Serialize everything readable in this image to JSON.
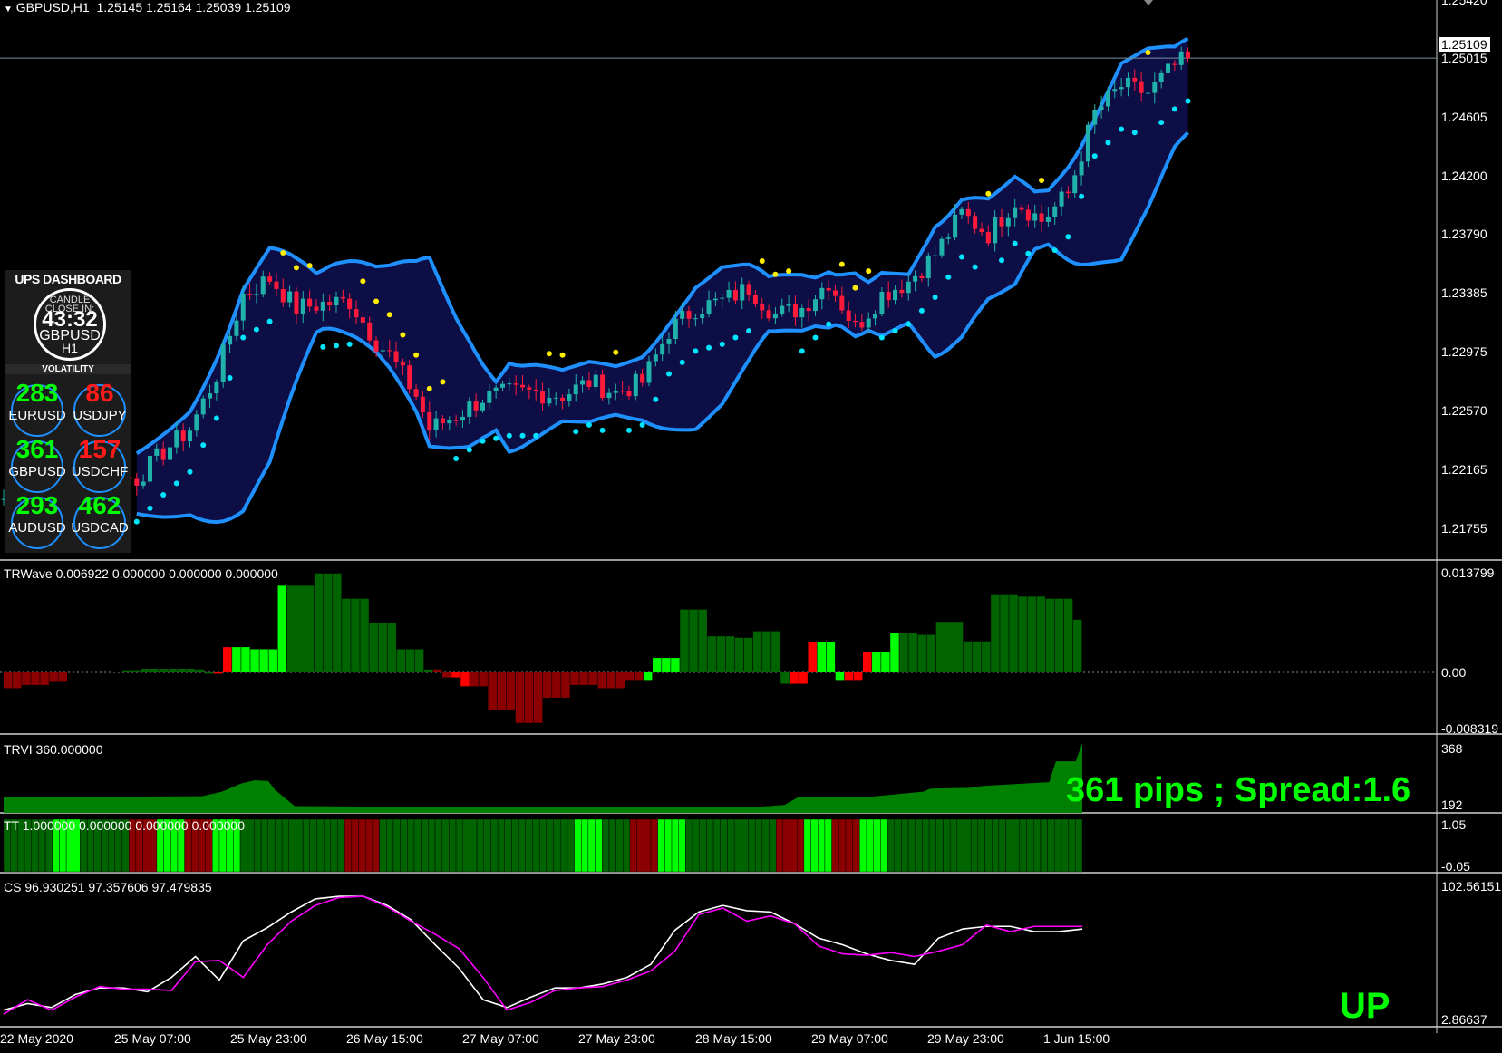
{
  "chart_header": {
    "symbol_label": "GBPUSD,H1",
    "ohlc": "1.25145 1.25164 1.25039 1.25109"
  },
  "price_axis": {
    "ticks": [
      "1.25420",
      "1.25015",
      "1.24605",
      "1.24200",
      "1.23790",
      "1.23385",
      "1.22975",
      "1.22570",
      "1.22165",
      "1.21755"
    ],
    "current_price": "1.25109"
  },
  "dashboard": {
    "title": "UPS DASHBOARD",
    "candle_close_label": "CANDLE CLOSE IN:",
    "timer": "43:32",
    "symbol": "GBPUSD",
    "timeframe": "H1",
    "volatility_label": "VOLATILITY",
    "pairs": [
      {
        "name": "EURUSD",
        "value": "283",
        "color": "#00ff00"
      },
      {
        "name": "USDJPY",
        "value": "86",
        "color": "#ff1a1a"
      },
      {
        "name": "GBPUSD",
        "value": "361",
        "color": "#00ff00"
      },
      {
        "name": "USDCHF",
        "value": "157",
        "color": "#ff1a1a"
      },
      {
        "name": "AUDUSD",
        "value": "293",
        "color": "#00ff00"
      },
      {
        "name": "USDCAD",
        "value": "462",
        "color": "#00ff00"
      }
    ]
  },
  "trwave": {
    "label": "TRWave 0.006922 0.000000 0.000000 0.000000",
    "axis": [
      "0.013799",
      "0.00",
      "-0.008319"
    ]
  },
  "trvi": {
    "label": "TRVI 360.000000",
    "axis": [
      "368",
      "192"
    ],
    "overlay": "361 pips ; Spread:1.6"
  },
  "tt": {
    "label": "TT 1.000000 0.000000 0.000000 0.000000",
    "axis": [
      "1.05",
      "-0.05"
    ]
  },
  "cs": {
    "label": "CS 96.930251 97.357606 97.479835",
    "axis": [
      "102.56151",
      "2.86637"
    ],
    "signal": "UP"
  },
  "time_axis": [
    "22 May 2020",
    "25 May 07:00",
    "25 May 23:00",
    "26 May 15:00",
    "27 May 07:00",
    "27 May 23:00",
    "28 May 15:00",
    "29 May 07:00",
    "29 May 23:00",
    "1 Jun 15:00"
  ],
  "colors": {
    "bull_candle": "#20b2aa",
    "bear_candle": "#ff1a3c",
    "band": "#1e90ff",
    "band_fill": "#1a1a80",
    "sar_up": "#00e5ff",
    "sar_down": "#ffee00",
    "hist_dark_green": "#006400",
    "hist_light_green": "#00ff00",
    "hist_dark_red": "#8b0000",
    "hist_red": "#ff0000",
    "cs_fast": "#ffffff",
    "cs_slow": "#ff00ff"
  },
  "chart_data": [
    {
      "type": "candlestick",
      "title": "GBPUSD,H1",
      "ylim": [
        1.2155,
        1.2542
      ],
      "close_trend": [
        [
          0,
          1.2183
        ],
        [
          4,
          1.2182
        ],
        [
          8,
          1.219
        ],
        [
          12,
          1.2195
        ],
        [
          16,
          1.2198
        ],
        [
          20,
          1.2198
        ],
        [
          24,
          1.2218
        ],
        [
          28,
          1.2235
        ],
        [
          32,
          1.2275
        ],
        [
          36,
          1.2335
        ],
        [
          40,
          1.2347
        ],
        [
          42,
          1.2336
        ],
        [
          44,
          1.2325
        ],
        [
          48,
          1.2328
        ],
        [
          52,
          1.233
        ],
        [
          56,
          1.23
        ],
        [
          58,
          1.229
        ],
        [
          62,
          1.226
        ],
        [
          64,
          1.2235
        ],
        [
          68,
          1.2245
        ],
        [
          72,
          1.2258
        ],
        [
          76,
          1.2262
        ],
        [
          80,
          1.2262
        ],
        [
          84,
          1.226
        ],
        [
          88,
          1.227
        ],
        [
          92,
          1.2262
        ],
        [
          96,
          1.227
        ],
        [
          100,
          1.2308
        ],
        [
          104,
          1.2325
        ],
        [
          108,
          1.233
        ],
        [
          112,
          1.234
        ],
        [
          116,
          1.232
        ],
        [
          120,
          1.2325
        ],
        [
          124,
          1.2345
        ],
        [
          128,
          1.231
        ],
        [
          132,
          1.2335
        ],
        [
          136,
          1.2345
        ],
        [
          140,
          1.2365
        ],
        [
          144,
          1.2395
        ],
        [
          148,
          1.238
        ],
        [
          152,
          1.2405
        ],
        [
          156,
          1.239
        ],
        [
          160,
          1.241
        ],
        [
          164,
          1.247
        ],
        [
          168,
          1.249
        ],
        [
          172,
          1.2485
        ],
        [
          176,
          1.2505
        ],
        [
          178,
          1.2511
        ]
      ]
    },
    {
      "type": "bar",
      "title": "TRWave",
      "ylim": [
        -0.008319,
        0.013799
      ],
      "values": [
        -0.0025,
        -0.0025,
        -0.002,
        -0.002,
        -0.002,
        -0.0015,
        -0.0015,
        0,
        0,
        0,
        0,
        0,
        0.0003,
        0.0003,
        0.0003,
        0.0005,
        0.0005,
        0.0005,
        0.0005,
        0.0005,
        0.0005,
        0.0004,
        -0.0002,
        -0.0002,
        0.0035,
        0.0035,
        0.0035,
        0.0032,
        0.0032,
        0.0032,
        0.012,
        0.012,
        0.012,
        0.012,
        0.0137,
        0.0137,
        0.0137,
        0.0102,
        0.0102,
        0.0102,
        0.0068,
        0.0068,
        0.0068,
        0.0032,
        0.0032,
        0.0032,
        0.0004,
        0.0004,
        -0.0008,
        -0.0008,
        -0.0022,
        -0.0022,
        -0.0022,
        -0.006,
        -0.006,
        -0.006,
        -0.008,
        -0.008,
        -0.008,
        -0.004,
        -0.004,
        -0.004,
        -0.002,
        -0.002,
        -0.002,
        -0.0025,
        -0.0025,
        -0.0025,
        -0.0012,
        -0.0012,
        -0.0012,
        0.002,
        0.002,
        0.002,
        0.0087,
        0.0087,
        0.0087,
        0.005,
        0.005,
        0.005,
        0.0048,
        0.0048,
        0.0057,
        0.0057,
        0.0057,
        -0.0018,
        -0.0018,
        -0.0018,
        0.0042,
        0.0042,
        0.0042,
        -0.0012,
        -0.0012,
        -0.0012,
        0.0028,
        0.0028,
        0.0028,
        0.0055,
        0.0055,
        0.0055,
        0.0052,
        0.0052,
        0.007,
        0.007,
        0.007,
        0.0043,
        0.0043,
        0.0043,
        0.0107,
        0.0107,
        0.0107,
        0.0105,
        0.0105,
        0.0105,
        0.0102,
        0.0102,
        0.0102,
        0.0073
      ],
      "color_codes": "RRRRRRR000000DDDDDDDDDDrrLLLLLLDDDDDDDDDDDDDDDDRRrrRRRRRRRRRRRRRRRRRRRLLLLDDDDDDDDDDDDrrrLLLrrrLLLDDDDDDDDDDDDDDDDDDDDDD"
    },
    {
      "type": "area",
      "title": "TRVI",
      "ylim": [
        192,
        368
      ],
      "x": [
        0,
        30,
        33,
        35,
        36,
        38,
        40,
        41,
        44,
        60,
        100,
        114,
        118,
        120,
        124,
        130,
        139,
        140,
        146,
        148,
        158,
        159,
        162,
        163
      ],
      "values": [
        225,
        228,
        240,
        255,
        262,
        270,
        268,
        245,
        202,
        200,
        200,
        200,
        205,
        225,
        225,
        225,
        240,
        248,
        250,
        255,
        265,
        320,
        320,
        368
      ]
    },
    {
      "type": "bar",
      "title": "TT",
      "ylim": [
        -0.05,
        1.05
      ],
      "color_codes": "DDDDDDDLLLLDDDDDDDRRRRLLLLRRRRLLLLDDDDDDDDDDDDDDDRRRRRDDDDDDDDDDDDDDDDDDDDDDDDDDDDLLLLDDDDRRRRLLLLDDDDDDDDDDDDDRRRRLLLLRRRRLLLLDDDDDDDDDDDDDDDDDDDDDDDDDDDD"
    },
    {
      "type": "line",
      "title": "CS",
      "ylim": [
        2.86637,
        102.56151
      ],
      "series": [
        {
          "values": [
            10,
            15,
            12,
            22,
            27,
            27,
            24,
            35,
            51,
            33,
            63,
            73,
            85,
            95,
            97,
            97,
            90,
            79,
            60,
            42,
            18,
            12,
            20,
            27,
            27,
            30,
            35,
            45,
            71,
            85,
            90,
            86,
            85,
            76,
            65,
            60,
            53,
            48,
            45,
            65,
            72,
            74,
            74,
            70,
            70,
            72
          ]
        },
        {
          "values": [
            7,
            18,
            10,
            20,
            28,
            26,
            26,
            25,
            47,
            48,
            35,
            60,
            78,
            90,
            96,
            97,
            89,
            78,
            68,
            57,
            35,
            10,
            16,
            25,
            27,
            28,
            33,
            40,
            55,
            83,
            88,
            78,
            82,
            76,
            59,
            53,
            52,
            54,
            51,
            55,
            60,
            75,
            70,
            74,
            74,
            74
          ]
        }
      ]
    }
  ]
}
